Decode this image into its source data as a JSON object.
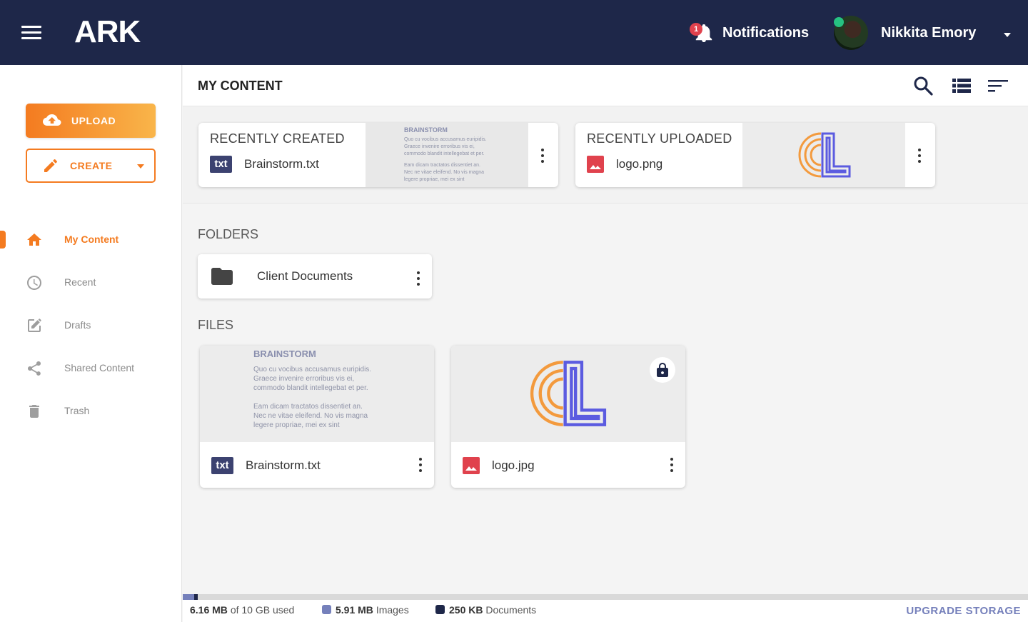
{
  "app": {
    "brand": "ARK"
  },
  "header": {
    "notifications_label": "Notifications",
    "notifications_count": "1",
    "user_name": "Nikkita Emory"
  },
  "sidebar": {
    "upload_label": "UPLOAD",
    "create_label": "CREATE",
    "items": [
      {
        "label": "My Content",
        "icon": "home-icon",
        "active": true
      },
      {
        "label": "Recent",
        "icon": "clock-icon",
        "active": false
      },
      {
        "label": "Drafts",
        "icon": "edit-icon",
        "active": false
      },
      {
        "label": "Shared Content",
        "icon": "share-icon",
        "active": false
      },
      {
        "label": "Trash",
        "icon": "trash-icon",
        "active": false
      }
    ]
  },
  "main": {
    "title": "MY CONTENT",
    "recent_created": {
      "label": "RECENTLY CREATED",
      "file_name": "Brainstorm.txt",
      "type_badge": "txt"
    },
    "recent_uploaded": {
      "label": "RECENTLY UPLOADED",
      "file_name": "logo.png"
    },
    "folders_label": "FOLDERS",
    "folders": [
      {
        "name": "Client Documents"
      }
    ],
    "files_label": "FILES",
    "files": [
      {
        "name": "Brainstorm.txt",
        "type_badge": "txt"
      },
      {
        "name": "logo.jpg",
        "locked": true
      }
    ],
    "doc_preview": {
      "title": "BRAINSTORM",
      "para1": [
        "Quo cu vocibus accusamus euripidis.",
        "Graece invenire erroribus vis ei,",
        "commodo blandit intellegebat et per."
      ],
      "para2": [
        "Eam dicam tractatos dissentiet an.",
        "Nec ne vitae eleifend. No vis magna",
        "legere propriae, mei ex sint"
      ]
    }
  },
  "storage": {
    "used": "6.16 MB",
    "of_text": "of 10 GB used",
    "images_size": "5.91 MB",
    "images_label": "Images",
    "docs_size": "250 KB",
    "docs_label": "Documents",
    "upgrade_label": "UPGRADE STORAGE",
    "used_fraction": 0.0006
  },
  "colors": {
    "topbar": "#1e2749",
    "accent": "#f47b20",
    "images": "#7580bb",
    "documents": "#1e2749",
    "badge": "#e0424d"
  }
}
